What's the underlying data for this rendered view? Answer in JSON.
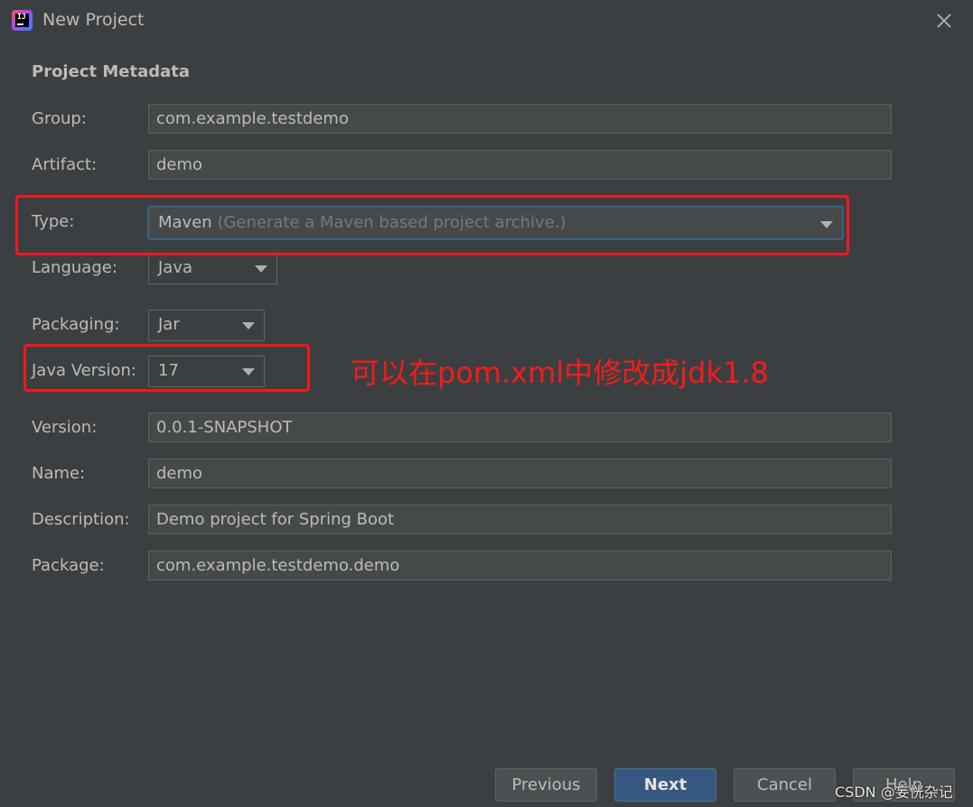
{
  "window": {
    "title": "New Project",
    "icon": "intellij-idea-icon",
    "close_icon": "close-icon"
  },
  "section": {
    "title": "Project Metadata"
  },
  "form": {
    "group": {
      "label": "Group:",
      "value": "com.example.testdemo"
    },
    "artifact": {
      "label": "Artifact:",
      "value": "demo"
    },
    "type": {
      "label": "Type:",
      "value": "Maven",
      "hint": "(Generate a Maven based project archive.)"
    },
    "language": {
      "label": "Language:",
      "value": "Java"
    },
    "packaging": {
      "label": "Packaging:",
      "value": "Jar"
    },
    "java_version": {
      "label": "Java Version:",
      "value": "17"
    },
    "version": {
      "label": "Version:",
      "value": "0.0.1-SNAPSHOT"
    },
    "name": {
      "label": "Name:",
      "value": "demo"
    },
    "description": {
      "label": "Description:",
      "value": "Demo project for Spring Boot"
    },
    "package": {
      "label": "Package:",
      "value": "com.example.testdemo.demo"
    }
  },
  "annotation": {
    "text": "可以在pom.xml中修改成jdk1.8",
    "color": "#f31c1c"
  },
  "buttons": {
    "previous": "Previous",
    "next": "Next",
    "cancel": "Cancel",
    "help": "Help"
  },
  "watermark": "CSDN @妄恍杂记",
  "colors": {
    "background": "#3c3f41",
    "field": "#45494a",
    "accent": "#365880",
    "annotation_red": "#f3161c"
  }
}
